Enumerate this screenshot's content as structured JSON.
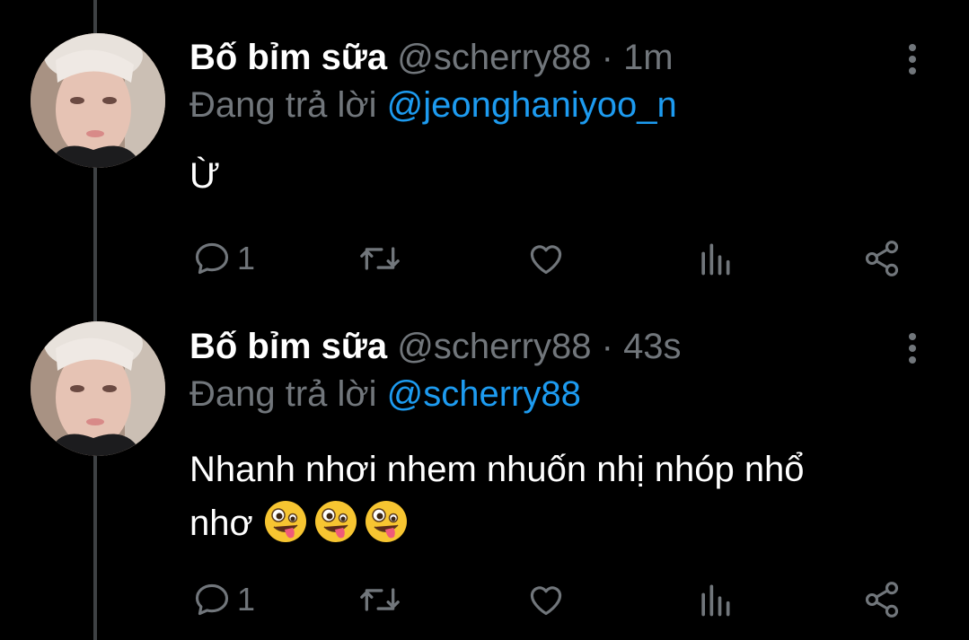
{
  "tweets": [
    {
      "name": "Bố bỉm sữa",
      "handle": "@scherry88",
      "dot": "·",
      "time": "1m",
      "reply_prefix": "Đang trả lời",
      "reply_to": "@jeonghaniyoo_n",
      "text": "Ừ",
      "reply_count": "1"
    },
    {
      "name": "Bố bỉm sữa",
      "handle": "@scherry88",
      "dot": "·",
      "time": "43s",
      "reply_prefix": "Đang trả lời",
      "reply_to": "@scherry88",
      "text_line1": "Nhanh nhơi nhem nhuốn nhị nhóp nhổ",
      "text_line2": "nhơ",
      "emojis": [
        "zany-face",
        "zany-face",
        "zany-face"
      ],
      "reply_count": "1"
    }
  ],
  "icons": {
    "reply": "speech-bubble-icon",
    "retweet": "retweet-icon",
    "like": "heart-icon",
    "views": "bar-chart-icon",
    "share": "share-icon",
    "more": "vertical-dots-icon"
  },
  "colors": {
    "background": "#000000",
    "name": "#ffffff",
    "muted": "#71767b",
    "link": "#1d9bf0",
    "thread_line": "#3e4144"
  }
}
